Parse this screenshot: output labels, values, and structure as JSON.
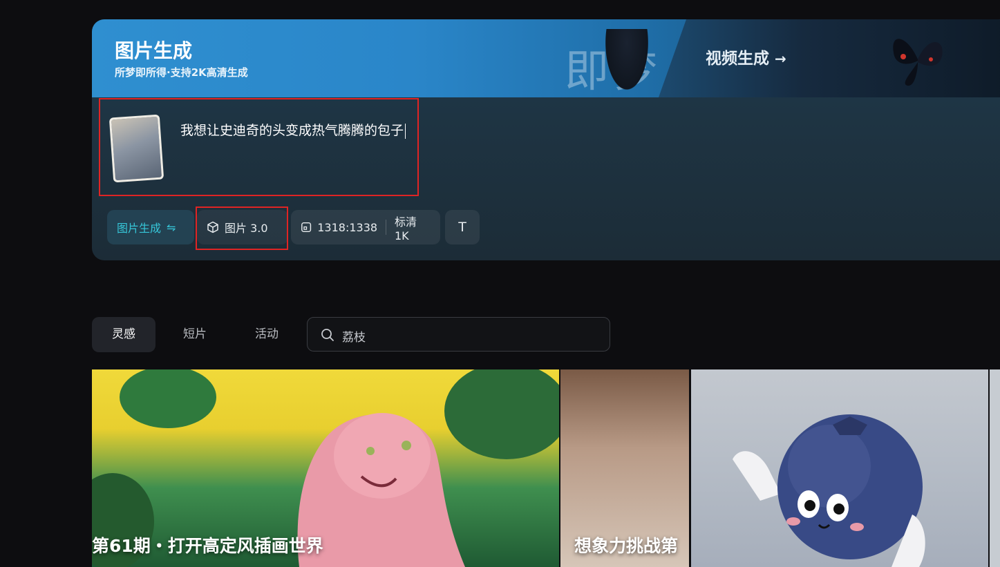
{
  "banner": {
    "title": "图片生成",
    "subtitle": "所梦即所得·支持2K高清生成",
    "art_text": "即梦",
    "video_link": "视频生成",
    "video_arrow": "→"
  },
  "prompt": {
    "text": "我想让史迪奇的头变成热气腾腾的包子"
  },
  "toolbar": {
    "mode_label": "图片生成",
    "mode_switch_glyph": "⇋",
    "model_label": "图片 3.0",
    "ratio_label": "1318:1338",
    "quality_label": "标清 1K",
    "text_tool_glyph": "T"
  },
  "tabs": [
    {
      "label": "灵感"
    },
    {
      "label": "短片"
    },
    {
      "label": "活动"
    }
  ],
  "search": {
    "value": "荔枝"
  },
  "gallery": [
    {
      "title": "第61期・打开高定风插画世界"
    },
    {
      "title": "想象力挑战第"
    },
    {
      "title": ""
    }
  ],
  "colors": {
    "accent_cyan": "#36c7d9",
    "highlight_red": "#e02424",
    "background": "#0d0d10"
  }
}
